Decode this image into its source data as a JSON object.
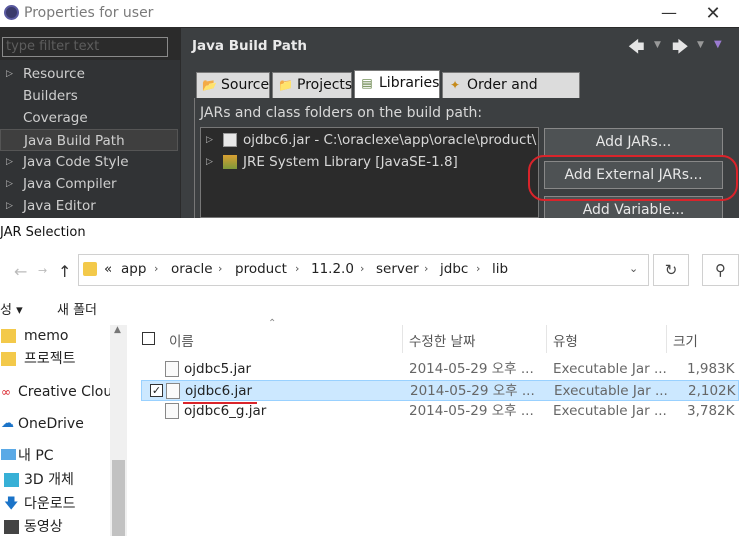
{
  "properties_window": {
    "title": "Properties for user",
    "window_controls": [
      "minimize-icon",
      "maximize-icon",
      "close-icon"
    ],
    "filter_placeholder": "type filter text",
    "nav_items": [
      {
        "label": "Resource",
        "expandable": true
      },
      {
        "label": "Builders",
        "expandable": false
      },
      {
        "label": "Coverage",
        "expandable": false
      },
      {
        "label": "Java Build Path",
        "expandable": false,
        "selected": true
      },
      {
        "label": "Java Code Style",
        "expandable": true
      },
      {
        "label": "Java Compiler",
        "expandable": true
      },
      {
        "label": "Java Editor",
        "expandable": true
      }
    ],
    "page_title": "Java Build Path",
    "tabs": [
      {
        "label": "Source",
        "icon": "source-folder-icon"
      },
      {
        "label": "Projects",
        "icon": "projects-folder-icon"
      },
      {
        "label": "Libraries",
        "icon": "libraries-icon",
        "active": true
      },
      {
        "label": "Order and Export",
        "icon": "order-export-icon"
      }
    ],
    "jars_label": "JARs and class folders on the build path:",
    "entries": [
      {
        "text": "ojdbc6.jar - C:\\oraclexe\\app\\oracle\\product\\",
        "icon": "jar-icon"
      },
      {
        "text": "JRE System Library [JavaSE-1.8]",
        "icon": "library-icon"
      }
    ],
    "buttons": {
      "add_jars": "Add JARs...",
      "add_external_jars": "Add External JARs...",
      "add_variable": "Add Variable..."
    }
  },
  "file_dialog": {
    "title": "JAR Selection",
    "breadcrumb": [
      "app",
      "oracle",
      "product",
      "11.2.0",
      "server",
      "jdbc",
      "lib"
    ],
    "breadcrumb_prefix": "«",
    "toolbar": {
      "organize": "성 ▾",
      "new_folder": "새 폴더"
    },
    "sidebar": [
      {
        "label": "memo",
        "icon": "folder-icon"
      },
      {
        "label": "프로젝트",
        "icon": "folder-icon"
      },
      {
        "label": "Creative Cloud",
        "icon": "creative-cloud-icon"
      },
      {
        "label": "OneDrive",
        "icon": "onedrive-icon"
      },
      {
        "label": "내 PC",
        "icon": "pc-icon"
      },
      {
        "label": "3D 개체",
        "icon": "3d-objects-icon"
      },
      {
        "label": "다운로드",
        "icon": "download-icon"
      },
      {
        "label": "동영상",
        "icon": "video-icon"
      }
    ],
    "columns": {
      "name": "이름",
      "date": "수정한 날짜",
      "type": "유형",
      "size": "크기"
    },
    "files": [
      {
        "name": "ojdbc5.jar",
        "date": "2014-05-29 오후 ...",
        "type": "Executable Jar ...",
        "size": "1,983K",
        "checked": false
      },
      {
        "name": "ojdbc6.jar",
        "date": "2014-05-29 오후 ...",
        "type": "Executable Jar ...",
        "size": "2,102K",
        "checked": true
      },
      {
        "name": "ojdbc6_g.jar",
        "date": "2014-05-29 오후 ...",
        "type": "Executable Jar ...",
        "size": "3,782K",
        "checked": false
      }
    ],
    "colors": {
      "selection": "#cce8ff",
      "annotation": "#d9242b"
    }
  }
}
